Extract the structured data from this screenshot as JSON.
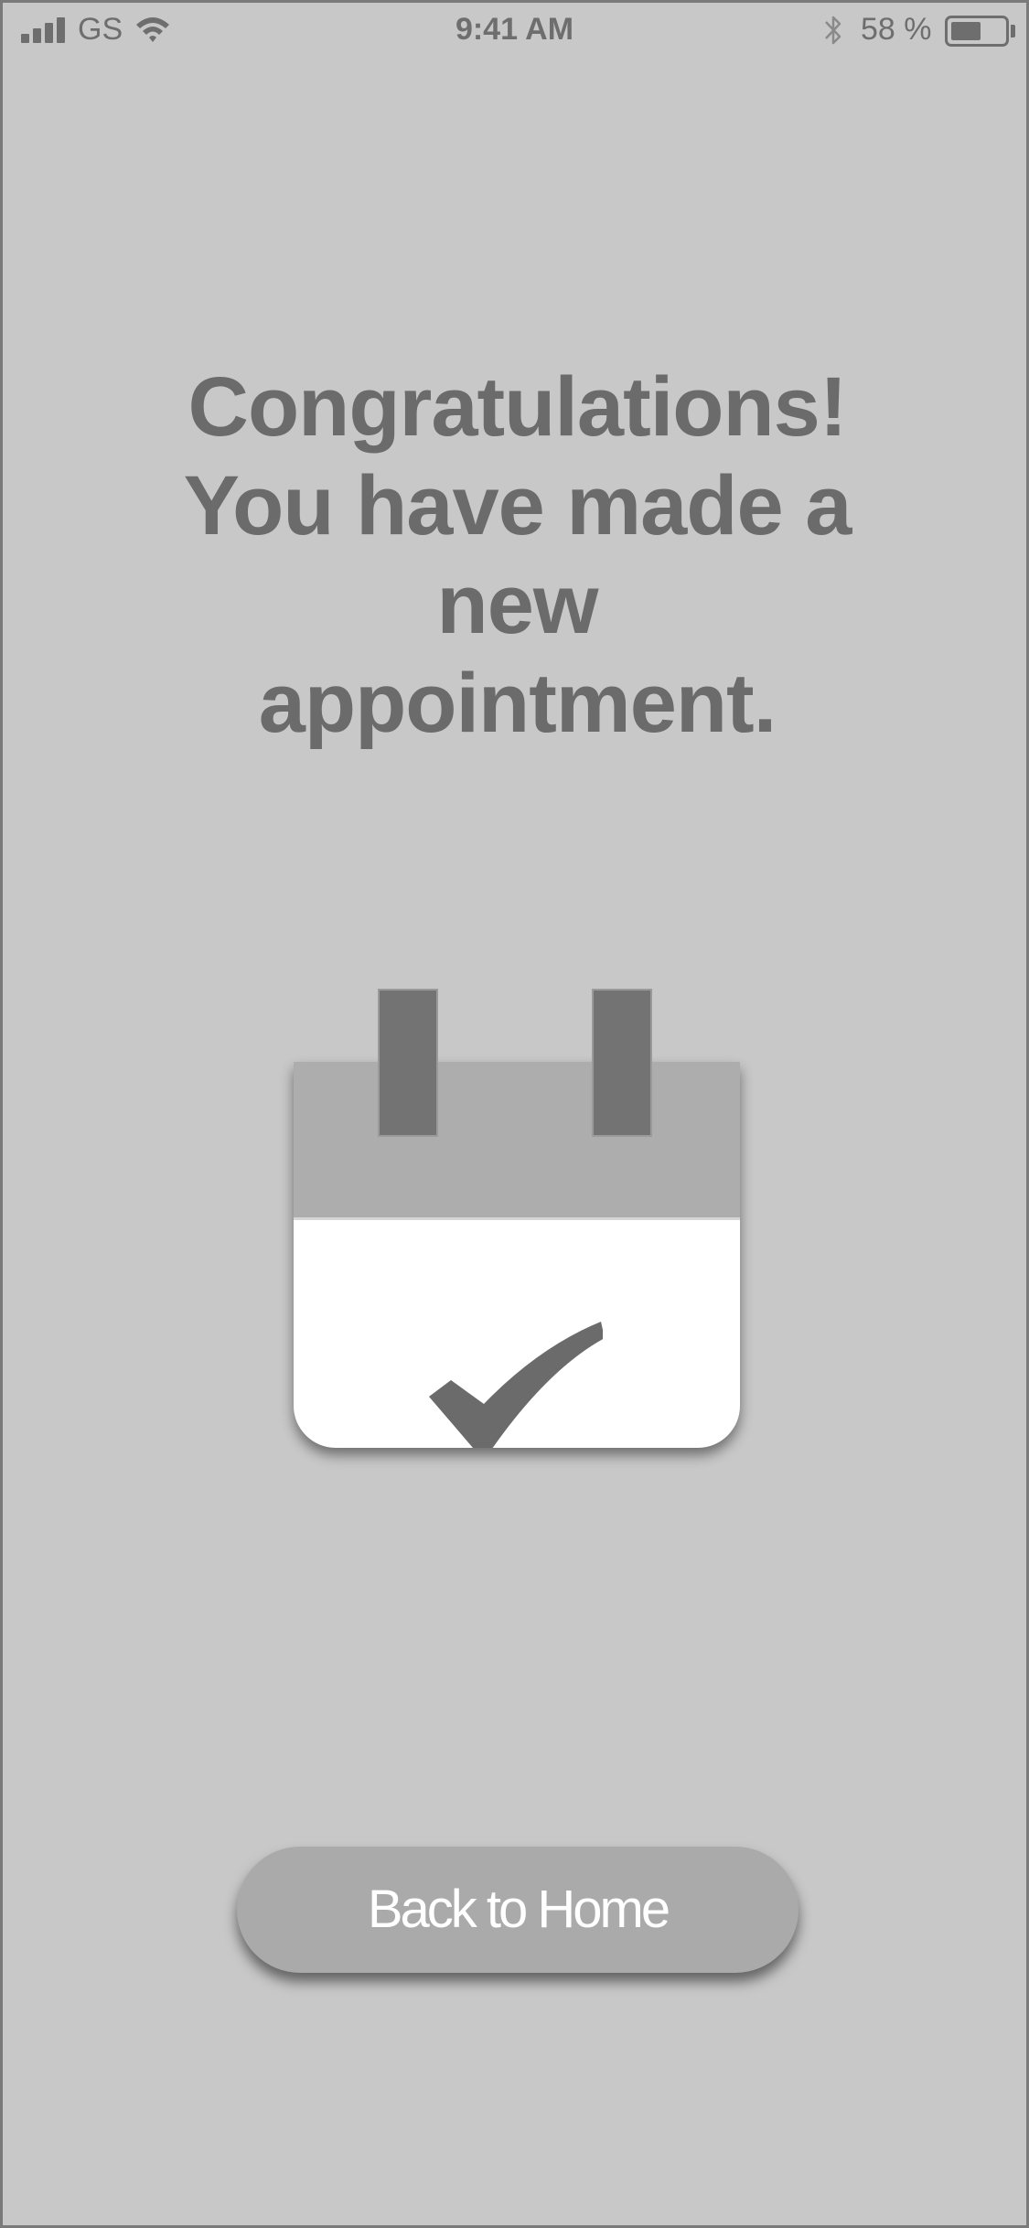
{
  "status_bar": {
    "carrier": "GS",
    "time": "9:41 AM",
    "battery_percent_label": "58 %",
    "battery_level": 0.58,
    "icons": [
      "signal-icon",
      "wifi-icon",
      "bluetooth-icon",
      "battery-icon"
    ]
  },
  "confirmation": {
    "line1": "Congratulations!",
    "line2": "You have made a",
    "line3": "new",
    "line4": "appointment."
  },
  "illustration": {
    "icon": "calendar-check-icon"
  },
  "actions": {
    "back_home_label": "Back to Home"
  },
  "colors": {
    "background": "#c8c8c8",
    "text": "#6b6b6b",
    "button": "#aaaaaa",
    "calendar_header": "#adadad",
    "calendar_tab": "#737373"
  }
}
